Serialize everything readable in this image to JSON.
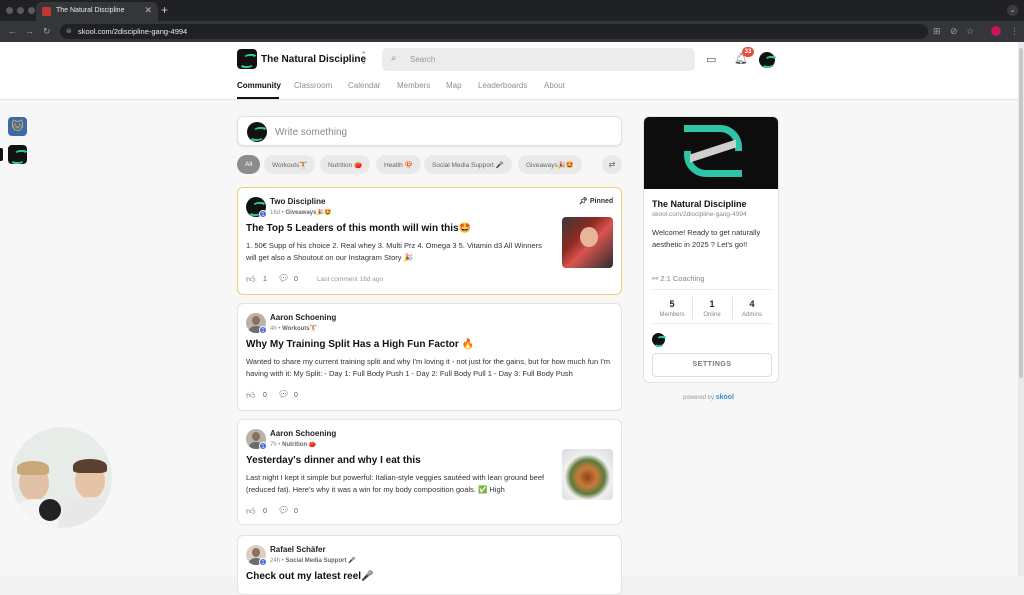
{
  "browser": {
    "tab_title": "The Natural Discipline",
    "url": "skool.com/2discipline-gang-4994",
    "new_tab": "+",
    "close": "✕"
  },
  "header": {
    "group_name": "The Natural Discipline",
    "search_placeholder": "Search",
    "notification_count": "33",
    "nav": [
      "Community",
      "Classroom",
      "Calendar",
      "Members",
      "Map",
      "Leaderboards",
      "About"
    ]
  },
  "composer": {
    "placeholder": "Write something"
  },
  "filters": [
    {
      "label": "All"
    },
    {
      "label": "Workouts🏋"
    },
    {
      "label": "Nutrition 🍅"
    },
    {
      "label": "Health 🍄"
    },
    {
      "label": "Social Media Support 🎤"
    },
    {
      "label": "Giveaways🎉🤩"
    }
  ],
  "posts": [
    {
      "author": "Two Discipline",
      "level": "1",
      "meta": "16d • ",
      "category": "Giveaways🎉🤩",
      "pinned_label": "Pinned",
      "title": "The Top 5 Leaders of this month will win this🤩",
      "body": "1. 50€ Supp of his choice 2. Real whey 3. Multi Prz 4. Omega 3 5. Vitamin d3 All Winners will get also a Shoutout on our Instagram Story 🎉",
      "likes": "1",
      "comments": "0",
      "last_comment": "Last comment 16d ago"
    },
    {
      "author": "Aaron Schoening",
      "level": "1",
      "meta": "4h • ",
      "category": "Workouts🏋",
      "title": "Why My Training Split Has a High Fun Factor 🔥",
      "body": "Wanted to share my current training split and why I'm loving it - not just for the gains, but for how much fun I'm having with it: My Split: - Day 1: Full Body Push 1 - Day 2: Full Body Pull 1 - Day 3: Full Body Push",
      "likes": "0",
      "comments": "0"
    },
    {
      "author": "Aaron Schoening",
      "level": "1",
      "meta": "7h • ",
      "category": "Nutrition 🍅",
      "title": "Yesterday's dinner and why I eat this",
      "body": "Last night I kept it simple but powerful: Italian-style veggies sautéed with lean ground beef (reduced fat). Here's why it was a win for my body composition goals. ✅ High",
      "likes": "0",
      "comments": "0"
    },
    {
      "author": "Rafael Schäfer",
      "level": "1",
      "meta": "24h • ",
      "category": "Social Media Support 🎤",
      "title": "Check out my latest reel🎤"
    }
  ],
  "sidebar_card": {
    "name": "The Natural Discipline",
    "url": "skool.com/2discipline-gang-4994",
    "description": "Welcome! Ready to get naturally aesthetic in 2025 ? Let's go!!",
    "link": "2:1 Coaching",
    "stats": [
      {
        "value": "5",
        "label": "Members"
      },
      {
        "value": "1",
        "label": "Online"
      },
      {
        "value": "4",
        "label": "Admins"
      }
    ],
    "settings_label": "SETTINGS"
  },
  "powered_by": {
    "prefix": "powered by ",
    "brand": "skool"
  },
  "colors": {
    "accent": "#2ec4a6",
    "level_badge": "#4a6bd1",
    "notif": "#e74c3c",
    "pinned_border": "#e9d27a"
  }
}
